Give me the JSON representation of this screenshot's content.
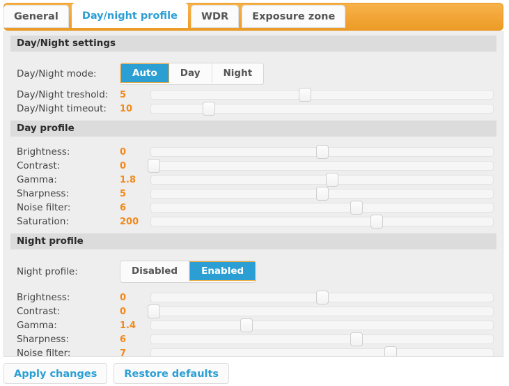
{
  "tabs": [
    {
      "label": "General",
      "active": false
    },
    {
      "label": "Day/night profile",
      "active": true
    },
    {
      "label": "WDR",
      "active": false
    },
    {
      "label": "Exposure zone",
      "active": false
    }
  ],
  "sections": {
    "daynight_settings": {
      "header": "Day/Night settings",
      "mode_label": "Day/Night mode:",
      "mode_options": [
        "Auto",
        "Day",
        "Night"
      ],
      "mode_selected": "Auto",
      "sliders": [
        {
          "label": "Day/Night treshold:",
          "value": "5",
          "percent": 45
        },
        {
          "label": "Day/Night timeout:",
          "value": "10",
          "percent": 17
        }
      ]
    },
    "day_profile": {
      "header": "Day profile",
      "sliders": [
        {
          "label": "Brightness:",
          "value": "0",
          "percent": 50
        },
        {
          "label": "Contrast:",
          "value": "0",
          "percent": 1
        },
        {
          "label": "Gamma:",
          "value": "1.8",
          "percent": 53
        },
        {
          "label": "Sharpness:",
          "value": "5",
          "percent": 50
        },
        {
          "label": "Noise filter:",
          "value": "6",
          "percent": 60
        },
        {
          "label": "Saturation:",
          "value": "200",
          "percent": 66
        }
      ]
    },
    "night_profile": {
      "header": "Night profile",
      "toggle_label": "Night profile:",
      "toggle_options": [
        "Disabled",
        "Enabled"
      ],
      "toggle_selected": "Enabled",
      "sliders": [
        {
          "label": "Brightness:",
          "value": "0",
          "percent": 50
        },
        {
          "label": "Contrast:",
          "value": "0",
          "percent": 1
        },
        {
          "label": "Gamma:",
          "value": "1.4",
          "percent": 28
        },
        {
          "label": "Sharpness:",
          "value": "6",
          "percent": 60
        },
        {
          "label": "Noise filter:",
          "value": "7",
          "percent": 70
        }
      ]
    }
  },
  "footer": {
    "apply_label": "Apply changes",
    "restore_label": "Restore defaults"
  },
  "colors": {
    "accent_orange": "#f2a434",
    "accent_blue": "#2b9fd4",
    "value_orange": "#f08a1e",
    "panel_bg": "#eeeeee",
    "section_bg": "#dcdcdc"
  }
}
